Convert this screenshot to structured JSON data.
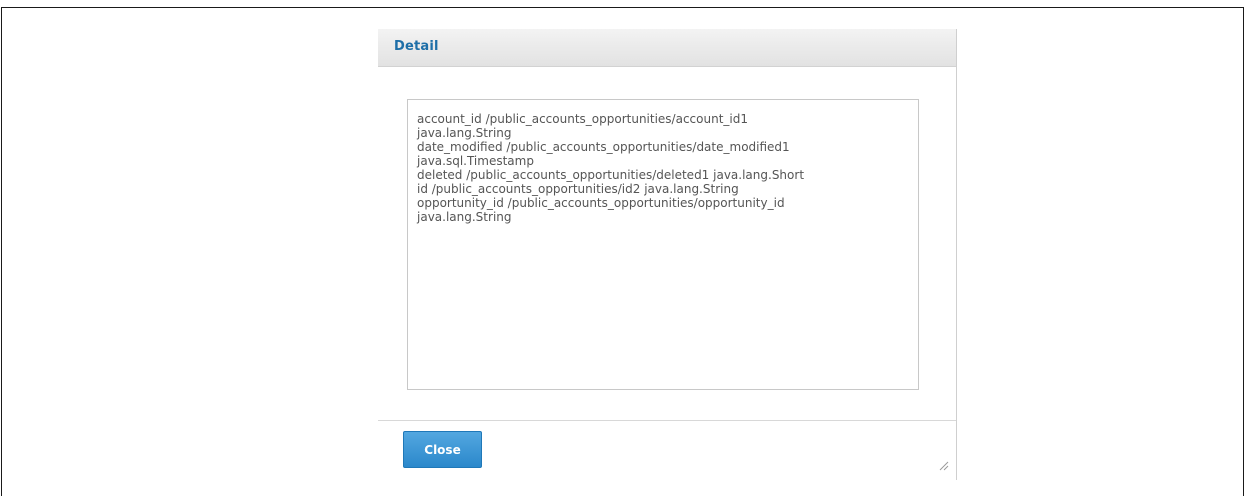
{
  "dialog": {
    "title": "Detail",
    "content": "account_id /public_accounts_opportunities/account_id1\njava.lang.String\ndate_modified /public_accounts_opportunities/date_modified1\njava.sql.Timestamp\ndeleted /public_accounts_opportunities/deleted1 java.lang.Short\nid /public_accounts_opportunities/id2 java.lang.String\nopportunity_id /public_accounts_opportunities/opportunity_id\njava.lang.String",
    "close_label": "Close",
    "resize_icon": "resize-grip-icon"
  },
  "colors": {
    "accent": "#2b88cb",
    "title": "#1e6fa8",
    "text": "#555555"
  }
}
